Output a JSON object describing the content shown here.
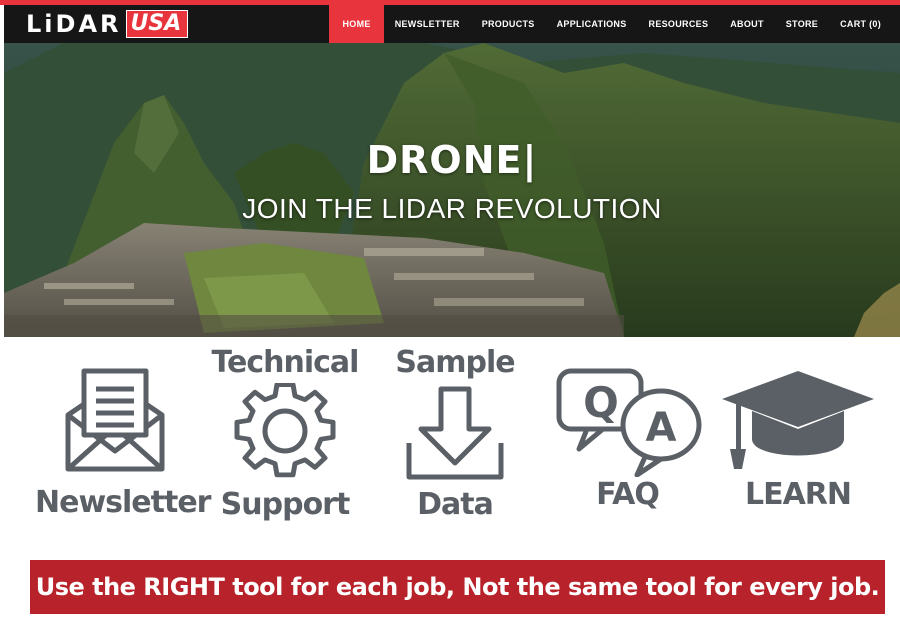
{
  "logo": {
    "part1": "LiDAR",
    "part2": "USA"
  },
  "nav": {
    "items": [
      {
        "label": "HOME",
        "active": true
      },
      {
        "label": "NEWSLETTER"
      },
      {
        "label": "PRODUCTS"
      },
      {
        "label": "APPLICATIONS"
      },
      {
        "label": "RESOURCES"
      },
      {
        "label": "ABOUT"
      },
      {
        "label": "STORE"
      },
      {
        "label": "CART (0)"
      }
    ]
  },
  "hero": {
    "title": "DRONE|",
    "subtitle": "JOIN THE LIDAR REVOLUTION"
  },
  "tiles": {
    "newsletter": {
      "label": "Newsletter",
      "icon": "envelope-icon"
    },
    "support": {
      "label_top": "Technical",
      "label_bottom": "Support",
      "icon": "gear-icon"
    },
    "sample": {
      "label_top": "Sample",
      "label_bottom": "Data",
      "icon": "download-icon"
    },
    "faq": {
      "label": "FAQ",
      "icon": "qa-bubbles-icon"
    },
    "learn": {
      "label": "LEARN",
      "icon": "graduation-cap-icon"
    }
  },
  "banner": {
    "text": "Use the RIGHT tool for each job, Not the same tool for every job."
  },
  "colors": {
    "accent": "#e8353d",
    "banner": "#b8222a",
    "icon": "#5b6066",
    "nav": "#161616"
  }
}
